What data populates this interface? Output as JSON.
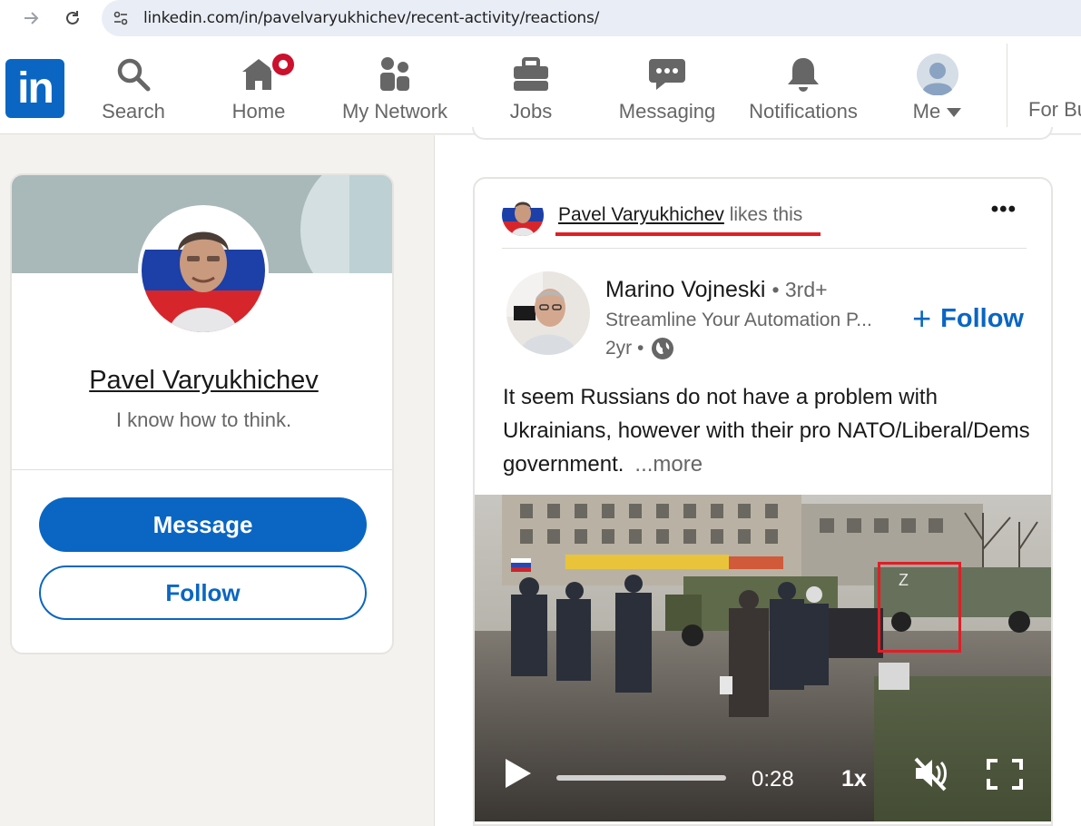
{
  "browser": {
    "url": "linkedin.com/in/pavelvaryukhichev/recent-activity/reactions/",
    "icons": [
      "arrow-forward-icon",
      "reload-icon",
      "site-settings-icon"
    ]
  },
  "header": {
    "logo": "in",
    "nav": [
      {
        "label": "Search",
        "icon": "search-icon"
      },
      {
        "label": "Home",
        "icon": "home-icon"
      },
      {
        "label": "My Network",
        "icon": "network-icon"
      },
      {
        "label": "Jobs",
        "icon": "briefcase-icon"
      },
      {
        "label": "Messaging",
        "icon": "messaging-icon"
      },
      {
        "label": "Notifications",
        "icon": "bell-icon"
      },
      {
        "label": "Me",
        "icon": "avatar"
      }
    ],
    "for_business": "For Bu"
  },
  "profile": {
    "name": "Pavel Varyukhichev",
    "headline": "I know how to think.",
    "message_label": "Message",
    "follow_label": "Follow"
  },
  "post": {
    "reactor_name": "Pavel Varyukhichev",
    "reaction_text": "likes this",
    "author_name": "Marino Vojneski",
    "author_degree": "• 3rd+",
    "author_headline": "Streamline Your Automation P...",
    "author_age": "2yr •",
    "follow_label": "Follow",
    "body": "It seem Russians do not have a problem with Ukrainians, however with their pro NATO/Liberal/Dems government.",
    "more_label": "...more",
    "video": {
      "time": "0:28",
      "speed": "1x",
      "progress": 0.0
    }
  },
  "colors": {
    "brand": "#0a66c2",
    "notification_badge": "#cb112d",
    "annotation_red": "#e01e26"
  }
}
